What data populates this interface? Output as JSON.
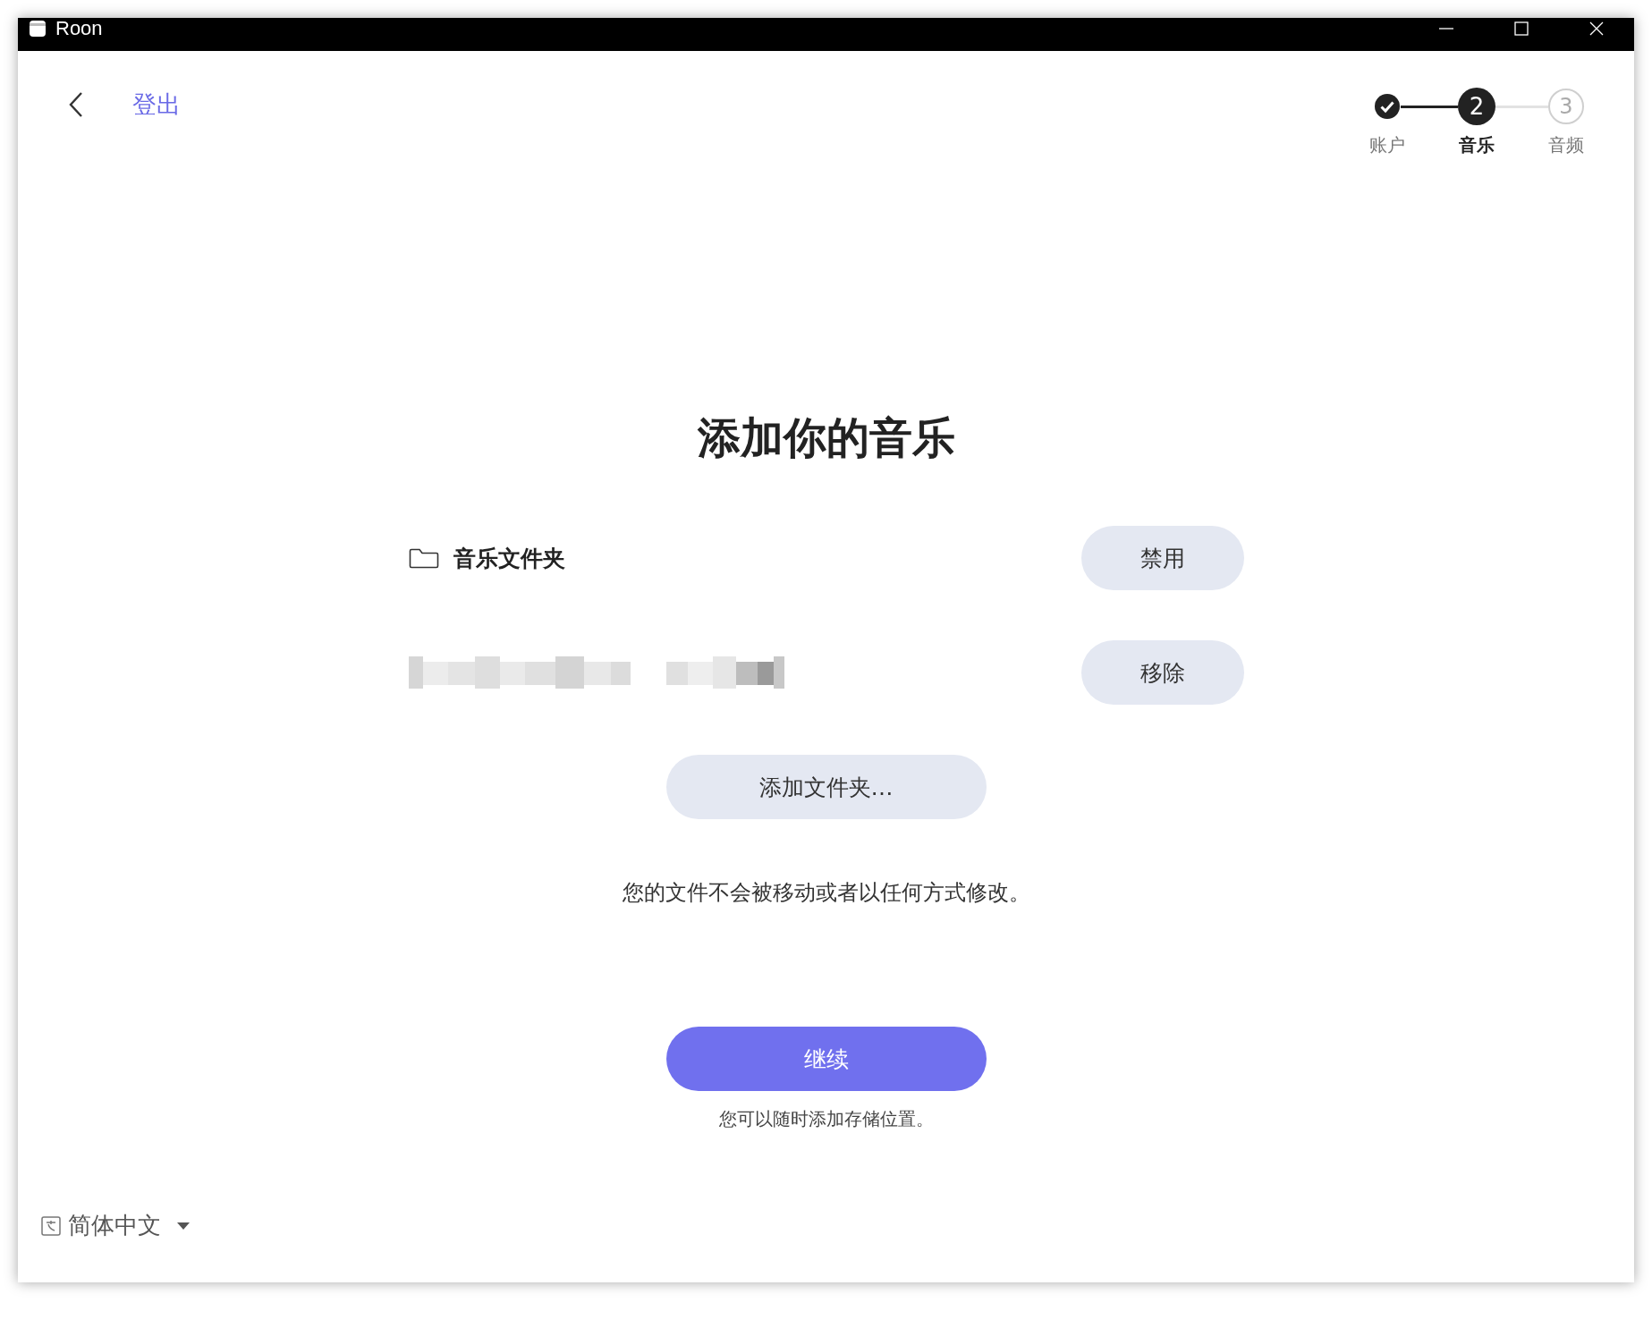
{
  "window": {
    "title": "Roon"
  },
  "header": {
    "back_link": "登出"
  },
  "steps": [
    {
      "label": "账户",
      "completed": true,
      "selected": false
    },
    {
      "label": "音乐",
      "number": "2",
      "completed": false,
      "selected": true
    },
    {
      "label": "音频",
      "number": "3",
      "completed": false,
      "selected": false
    }
  ],
  "heading": "添加你的音乐",
  "folders": [
    {
      "name": "音乐文件夹",
      "kind": "named",
      "button": "禁用"
    },
    {
      "kind": "redacted",
      "button": "移除"
    }
  ],
  "add_button": "添加文件夹…",
  "note": "您的文件不会被移动或者以任何方式修改。",
  "continue_button": "继续",
  "hint": "您可以随时添加存储位置。",
  "language": "简体中文"
}
